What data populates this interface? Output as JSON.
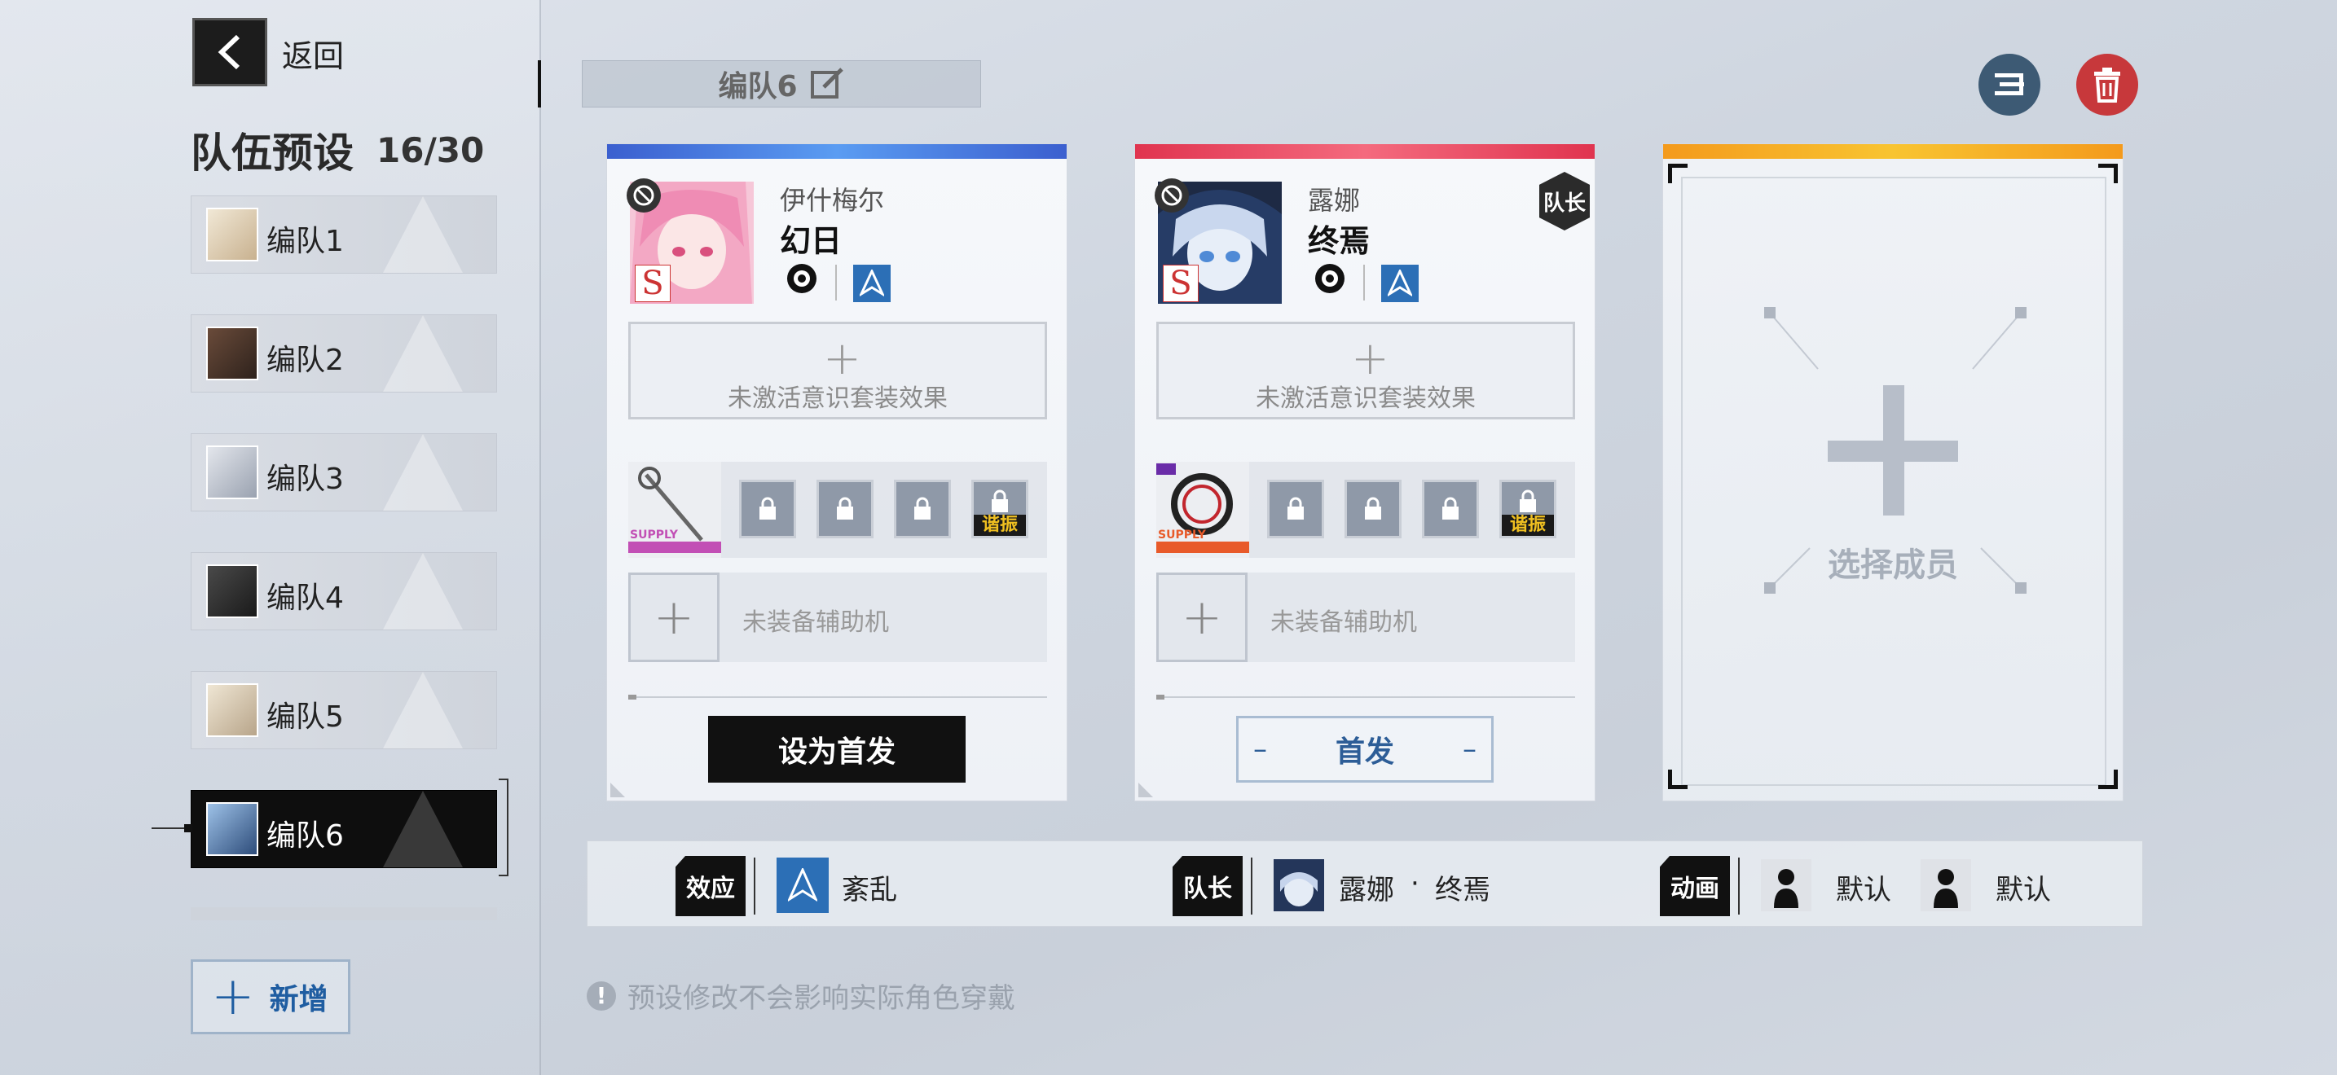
{
  "header": {
    "back_label": "返回",
    "preset_title": "队伍预设",
    "preset_count": "16/30",
    "team_name": "编队6"
  },
  "sidebar": {
    "teams": [
      {
        "label": "编队1"
      },
      {
        "label": "编队2"
      },
      {
        "label": "编队3"
      },
      {
        "label": "编队4"
      },
      {
        "label": "编队5"
      },
      {
        "label": "编队6",
        "active": true
      }
    ],
    "new_label": "新增"
  },
  "cards": [
    {
      "name_top": "伊什梅尔",
      "name_main": "幻日",
      "rank": "S",
      "suit_text": "未激活意识套装效果",
      "resonance_label": "谐振",
      "weapon_tag": "SUPPLY",
      "assist_text": "未装备辅助机",
      "action_label": "设为首发",
      "accent": "#3b6fd6"
    },
    {
      "name_top": "露娜",
      "name_main": "终焉",
      "rank": "S",
      "leader_label": "队长",
      "suit_text": "未激活意识套装效果",
      "resonance_label": "谐振",
      "weapon_tag": "SUPPLY",
      "assist_text": "未装备辅助机",
      "action_label": "首发",
      "accent": "#e0344f"
    }
  ],
  "empty_slot": {
    "label": "选择成员"
  },
  "info_bar": {
    "effect_tag": "效应",
    "effect_value": "紊乱",
    "leader_tag": "队长",
    "leader_name": "露娜",
    "leader_dot": "·",
    "leader_title": "终焉",
    "anim_tag": "动画",
    "anim_value_1": "默认",
    "anim_value_2": "默认"
  },
  "notice": {
    "icon": "!",
    "text": "预设修改不会影响实际角色穿戴"
  },
  "colors": {
    "blue_accent": "#3b6fd6",
    "red_accent": "#e0344f",
    "orange_accent": "#f49a1c",
    "link_blue": "#1f5da1"
  }
}
